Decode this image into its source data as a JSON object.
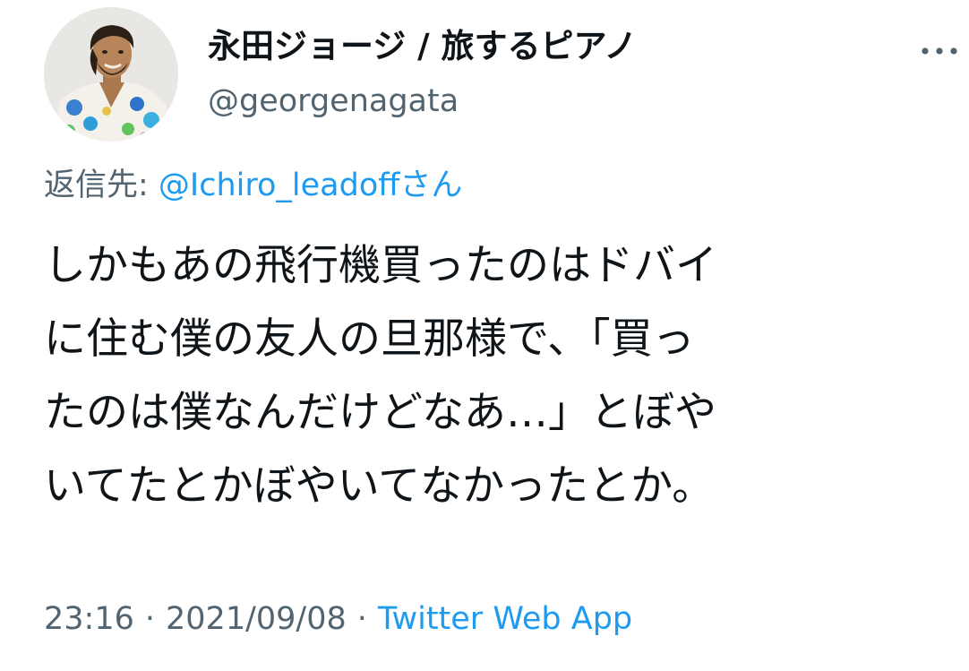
{
  "author": {
    "display_name": "永田ジョージ / 旅するピアノ",
    "handle": "@georgenagata"
  },
  "reply": {
    "prefix": "返信先: ",
    "user": "@Ichiro_leadoff",
    "suffix": "さん"
  },
  "tweet": {
    "lines": [
      "しかもあの飛行機買ったのはドバイ",
      "に住む僕の友人の旦那様で、「買っ",
      "たのは僕なんだけどなあ…」とぼや",
      "いてたとかぼやいてなかったとか。"
    ]
  },
  "meta": {
    "time": "23:16",
    "separator": "·",
    "date": "2021/09/08",
    "source": "Twitter Web App"
  },
  "icons": {
    "more": "more-horizontal-icon",
    "avatar": "profile-photo"
  },
  "colors": {
    "text": "#0f1419",
    "secondary": "#536471",
    "link": "#1d9bf0"
  }
}
